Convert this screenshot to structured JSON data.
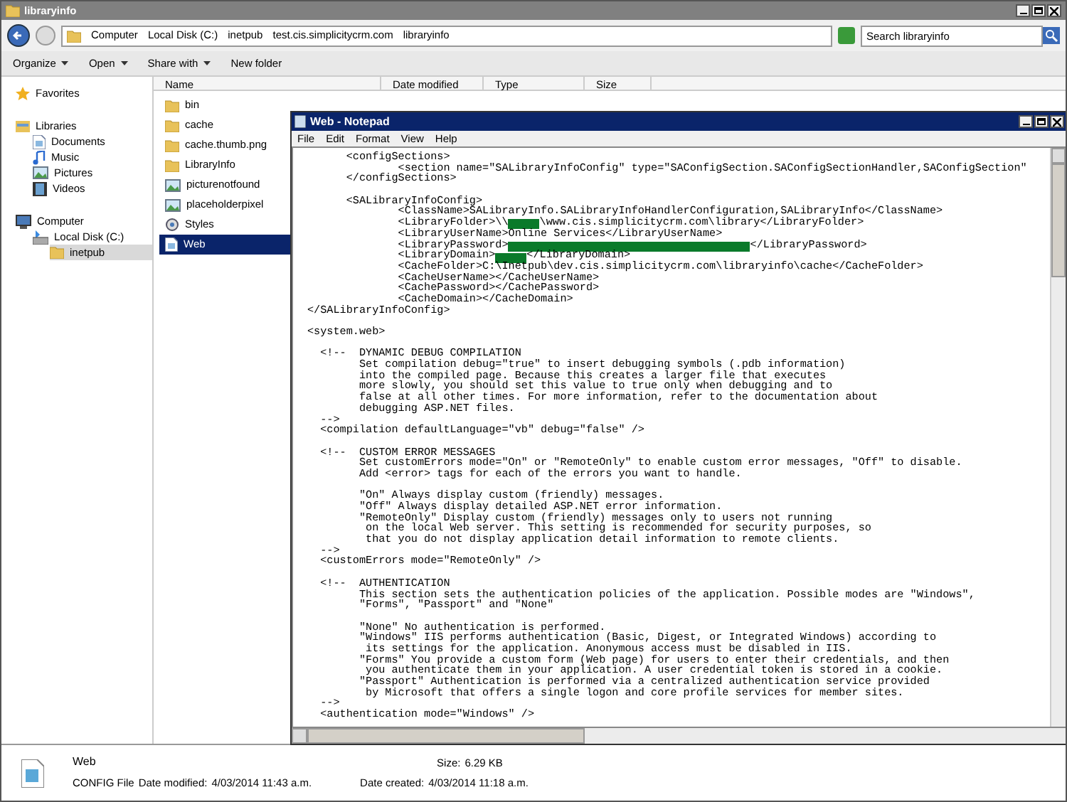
{
  "explorer": {
    "title": "libraryinfo",
    "breadcrumbs": [
      "Computer",
      "Local Disk (C:)",
      "inetpub",
      "test.cis.simplicitycrm.com",
      "libraryinfo"
    ],
    "search": {
      "placeholder": "Search libraryinfo"
    },
    "toolbar": [
      {
        "label": "Organize",
        "dropdown": true
      },
      {
        "label": "Open",
        "dropdown": true
      },
      {
        "label": "Share with",
        "dropdown": true
      },
      {
        "label": "New folder",
        "dropdown": false
      }
    ],
    "nav": [
      {
        "label": "Favorites",
        "kind": "star",
        "selected": false
      },
      {
        "label": "Libraries",
        "kind": "library",
        "selected": false,
        "children": [
          {
            "label": "Documents",
            "kind": "document",
            "selected": false
          },
          {
            "label": "Music",
            "kind": "music",
            "selected": false
          },
          {
            "label": "Pictures",
            "kind": "picture",
            "selected": false
          },
          {
            "label": "Videos",
            "kind": "video",
            "selected": false
          }
        ]
      },
      {
        "label": "Computer",
        "kind": "computer",
        "selected": false,
        "children": [
          {
            "label": "Local Disk (C:)",
            "kind": "disk",
            "selected": false,
            "children": [
              {
                "label": "inetpub",
                "kind": "folder",
                "selected": true
              }
            ]
          }
        ]
      }
    ],
    "columns": [
      "Name",
      "Date modified",
      "Type",
      "Size"
    ],
    "files": [
      {
        "name": "bin",
        "kind": "folder",
        "selected": false
      },
      {
        "name": "cache",
        "kind": "folder",
        "selected": false
      },
      {
        "name": "cache.thumb.png",
        "kind": "folder",
        "selected": false
      },
      {
        "name": "LibraryInfo",
        "kind": "folder",
        "selected": false
      },
      {
        "name": "picturenotfound",
        "kind": "image",
        "selected": false
      },
      {
        "name": "placeholderpixel",
        "kind": "image",
        "selected": false
      },
      {
        "name": "Styles",
        "kind": "settings",
        "selected": false
      },
      {
        "name": "Web",
        "kind": "document",
        "selected": true
      }
    ],
    "details": {
      "name": "Web",
      "type": "CONFIG File",
      "modified_label": "Date modified:",
      "modified": "4/03/2014 11:43 a.m.",
      "size_label": "Size:",
      "size": "6.29 KB",
      "created_label": "Date created:",
      "created": "4/03/2014 11:18 a.m."
    }
  },
  "notepad": {
    "title": "Web - Notepad",
    "menu": [
      "File",
      "Edit",
      "Format",
      "View",
      "Help"
    ],
    "lines": [
      {
        "kind": "text",
        "text": "      <configSections>"
      },
      {
        "kind": "text",
        "text": "              <section name=\"SALibraryInfoConfig\" type=\"SAConfigSection.SAConfigSectionHandler,SAConfigSection\""
      },
      {
        "kind": "text",
        "text": "      </configSections>"
      },
      {
        "kind": "blank"
      },
      {
        "kind": "text",
        "text": "      <SALibraryInfoConfig>"
      },
      {
        "kind": "text",
        "text": "              <ClassName>SALibraryInfo.SALibraryInfoHandlerConfiguration,SALibraryInfo</ClassName>"
      },
      {
        "kind": "mixed",
        "parts": [
          {
            "kind": "text",
            "text": "              <LibraryFolder>\\\\"
          },
          {
            "kind": "redaction",
            "long": false
          },
          {
            "kind": "text",
            "text": "\\www.cis.simplicitycrm.com\\library</LibraryFolder>"
          }
        ]
      },
      {
        "kind": "text",
        "text": "              <LibraryUserName>Online Services</LibraryUserName>"
      },
      {
        "kind": "mixed",
        "parts": [
          {
            "kind": "text",
            "text": "              <LibraryPassword>"
          },
          {
            "kind": "redaction",
            "long": true
          },
          {
            "kind": "text",
            "text": "</LibraryPassword>"
          }
        ]
      },
      {
        "kind": "mixed",
        "parts": [
          {
            "kind": "text",
            "text": "              <LibraryDomain>"
          },
          {
            "kind": "redaction",
            "long": false
          },
          {
            "kind": "text",
            "text": "</LibraryDomain>"
          }
        ]
      },
      {
        "kind": "text",
        "text": "              <CacheFolder>C:\\Inetpub\\dev.cis.simplicitycrm.com\\libraryinfo\\cache</CacheFolder>"
      },
      {
        "kind": "text",
        "text": "              <CacheUserName></CacheUserName>"
      },
      {
        "kind": "text",
        "text": "              <CachePassword></CachePassword>"
      },
      {
        "kind": "text",
        "text": "              <CacheDomain></CacheDomain>"
      },
      {
        "kind": "text",
        "text": "</SALibraryInfoConfig>"
      },
      {
        "kind": "blank"
      },
      {
        "kind": "text",
        "text": "<system.web>"
      },
      {
        "kind": "blank"
      },
      {
        "kind": "text",
        "text": "  <!--  DYNAMIC DEBUG COMPILATION"
      },
      {
        "kind": "text",
        "text": "        Set compilation debug=\"true\" to insert debugging symbols (.pdb information)"
      },
      {
        "kind": "text",
        "text": "        into the compiled page. Because this creates a larger file that executes"
      },
      {
        "kind": "text",
        "text": "        more slowly, you should set this value to true only when debugging and to"
      },
      {
        "kind": "text",
        "text": "        false at all other times. For more information, refer to the documentation about"
      },
      {
        "kind": "text",
        "text": "        debugging ASP.NET files."
      },
      {
        "kind": "text",
        "text": "  -->"
      },
      {
        "kind": "text",
        "text": "  <compilation defaultLanguage=\"vb\" debug=\"false\" />"
      },
      {
        "kind": "blank"
      },
      {
        "kind": "text",
        "text": "  <!--  CUSTOM ERROR MESSAGES"
      },
      {
        "kind": "text",
        "text": "        Set customErrors mode=\"On\" or \"RemoteOnly\" to enable custom error messages, \"Off\" to disable."
      },
      {
        "kind": "text",
        "text": "        Add <error> tags for each of the errors you want to handle."
      },
      {
        "kind": "blank"
      },
      {
        "kind": "text",
        "text": "        \"On\" Always display custom (friendly) messages."
      },
      {
        "kind": "text",
        "text": "        \"Off\" Always display detailed ASP.NET error information."
      },
      {
        "kind": "text",
        "text": "        \"RemoteOnly\" Display custom (friendly) messages only to users not running"
      },
      {
        "kind": "text",
        "text": "         on the local Web server. This setting is recommended for security purposes, so"
      },
      {
        "kind": "text",
        "text": "         that you do not display application detail information to remote clients."
      },
      {
        "kind": "text",
        "text": "  -->"
      },
      {
        "kind": "text",
        "text": "  <customErrors mode=\"RemoteOnly\" />"
      },
      {
        "kind": "blank"
      },
      {
        "kind": "text",
        "text": "  <!--  AUTHENTICATION"
      },
      {
        "kind": "text",
        "text": "        This section sets the authentication policies of the application. Possible modes are \"Windows\","
      },
      {
        "kind": "text",
        "text": "        \"Forms\", \"Passport\" and \"None\""
      },
      {
        "kind": "blank"
      },
      {
        "kind": "text",
        "text": "        \"None\" No authentication is performed."
      },
      {
        "kind": "text",
        "text": "        \"Windows\" IIS performs authentication (Basic, Digest, or Integrated Windows) according to"
      },
      {
        "kind": "text",
        "text": "         its settings for the application. Anonymous access must be disabled in IIS."
      },
      {
        "kind": "text",
        "text": "        \"Forms\" You provide a custom form (Web page) for users to enter their credentials, and then"
      },
      {
        "kind": "text",
        "text": "         you authenticate them in your application. A user credential token is stored in a cookie."
      },
      {
        "kind": "text",
        "text": "        \"Passport\" Authentication is performed via a centralized authentication service provided"
      },
      {
        "kind": "text",
        "text": "         by Microsoft that offers a single logon and core profile services for member sites."
      },
      {
        "kind": "text",
        "text": "  -->"
      },
      {
        "kind": "text",
        "text": "  <authentication mode=\"Windows\" />"
      }
    ]
  }
}
